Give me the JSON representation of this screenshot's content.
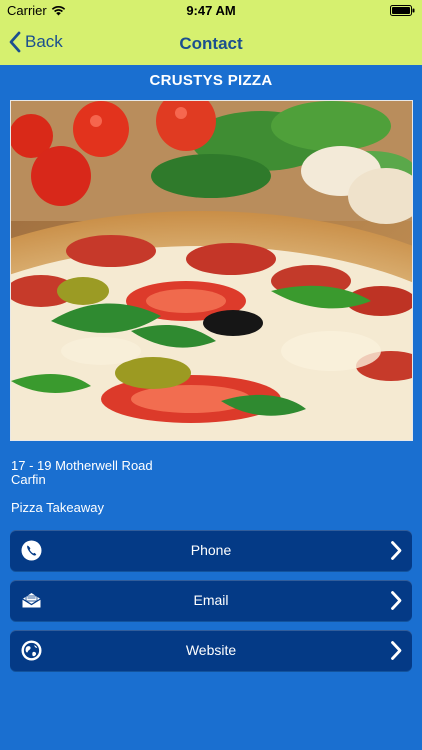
{
  "status_bar": {
    "carrier": "Carrier",
    "time": "9:47 AM"
  },
  "nav": {
    "back_label": "Back",
    "title": "Contact"
  },
  "business": {
    "name": "CRUSTYS PIZZA",
    "address_line1": "17 - 19 Motherwell Road",
    "address_line2": "Carfin",
    "category": "Pizza Takeaway"
  },
  "actions": [
    {
      "label": "Phone",
      "icon": "phone-icon"
    },
    {
      "label": "Email",
      "icon": "email-icon"
    },
    {
      "label": "Website",
      "icon": "globe-icon"
    }
  ],
  "colors": {
    "nav_background": "#d6f06f",
    "page_background": "#1a6fd0",
    "button_background": "#043a86",
    "nav_text": "#1b4f8f"
  }
}
